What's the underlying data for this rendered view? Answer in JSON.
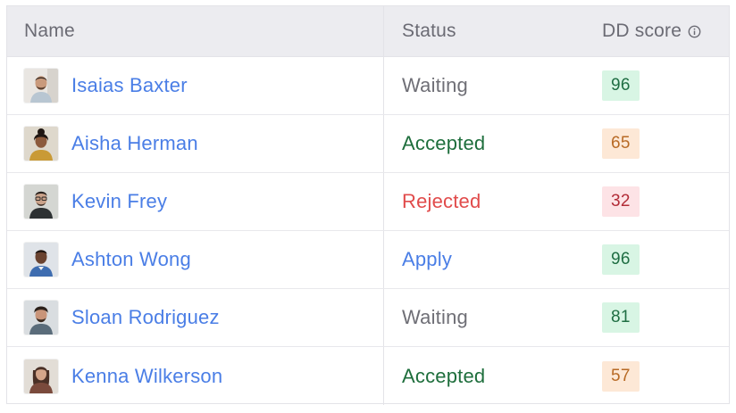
{
  "columns": {
    "name": "Name",
    "status": "Status",
    "score": "DD score",
    "score_icon": "info-icon"
  },
  "status_colors": {
    "Waiting": "#6f6f76",
    "Accepted": "#1e6e3c",
    "Rejected": "#e14b4b",
    "Apply": "#4a7ee6"
  },
  "score_colors": {
    "high": {
      "bg": "#d8f5e4",
      "fg": "#1f6e43"
    },
    "mid": {
      "bg": "#fde8d6",
      "fg": "#b86a25"
    },
    "low": {
      "bg": "#fde3e6",
      "fg": "#b22c37"
    }
  },
  "rows": [
    {
      "name": "Isaias Baxter",
      "status": "Waiting",
      "score": "96",
      "score_level": "high",
      "avatar_icon": "avatar-man-beard-icon"
    },
    {
      "name": "Aisha Herman",
      "status": "Accepted",
      "score": "65",
      "score_level": "mid",
      "avatar_icon": "avatar-woman-icon"
    },
    {
      "name": "Kevin Frey",
      "status": "Rejected",
      "score": "32",
      "score_level": "low",
      "avatar_icon": "avatar-man-glasses-icon"
    },
    {
      "name": "Ashton Wong",
      "status": "Apply",
      "score": "96",
      "score_level": "high",
      "avatar_icon": "avatar-man-icon"
    },
    {
      "name": "Sloan Rodriguez",
      "status": "Waiting",
      "score": "81",
      "score_level": "high",
      "avatar_icon": "avatar-man-icon"
    },
    {
      "name": "Kenna Wilkerson",
      "status": "Accepted",
      "score": "57",
      "score_level": "mid",
      "avatar_icon": "avatar-woman-icon"
    }
  ]
}
